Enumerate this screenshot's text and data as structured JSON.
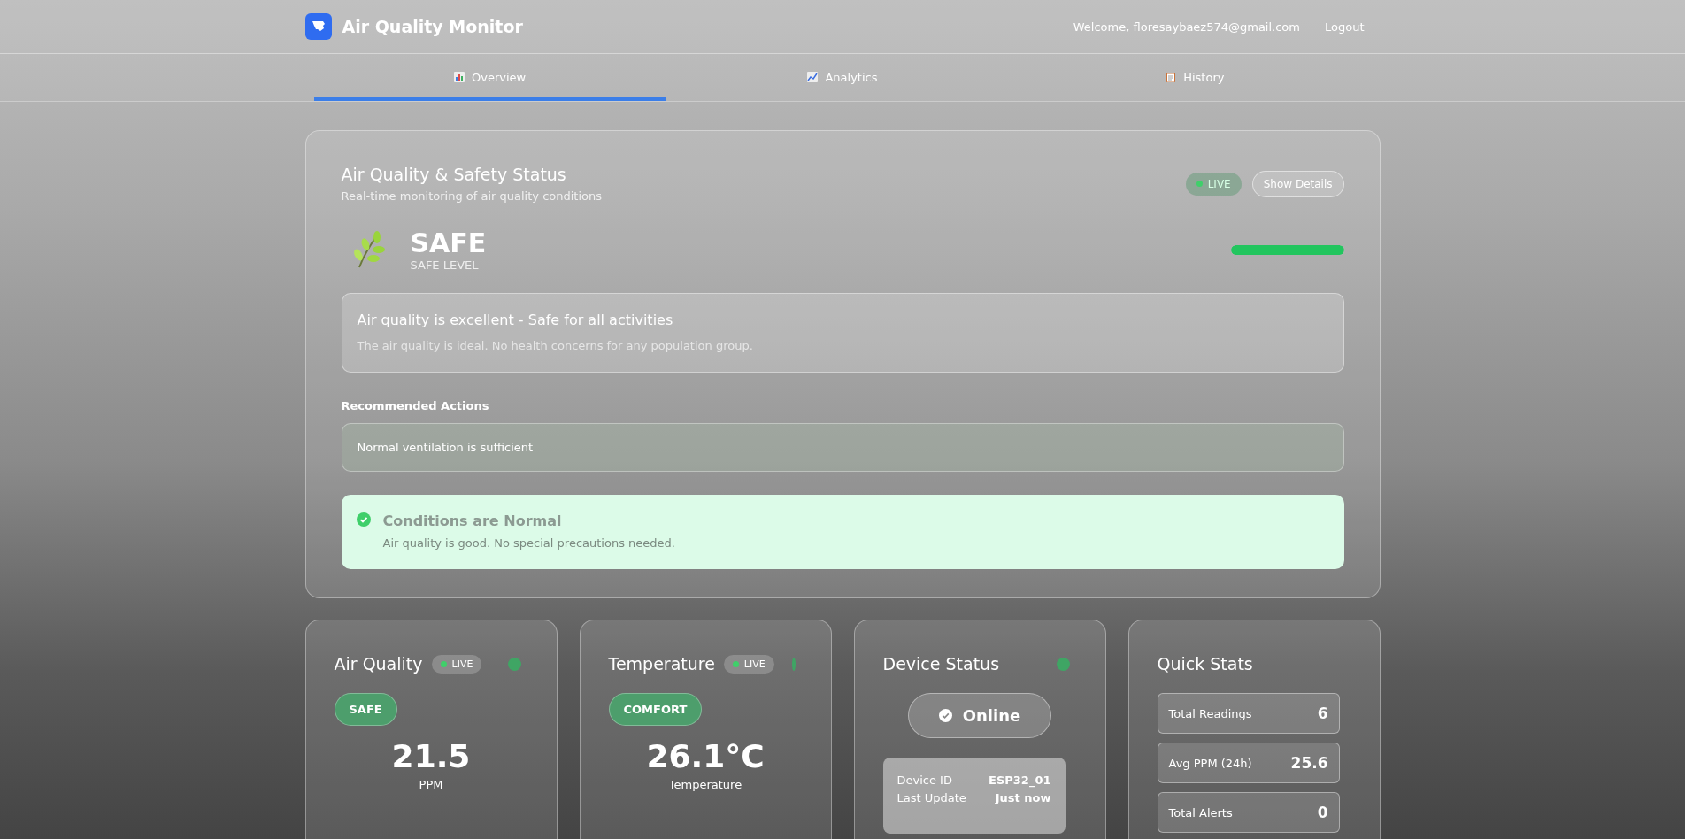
{
  "header": {
    "title": "Air Quality Monitor",
    "welcome": "Welcome, floresaybaez574@gmail.com",
    "logout": "Logout"
  },
  "tabs": [
    {
      "label": "Overview",
      "selected": true
    },
    {
      "label": "Analytics",
      "selected": false
    },
    {
      "label": "History",
      "selected": false
    }
  ],
  "status": {
    "title": "Air Quality & Safety Status",
    "subtitle": "Real-time monitoring of air quality conditions",
    "live": "LIVE",
    "details_button": "Show Details",
    "level_name": "SAFE",
    "level_caption": "SAFE LEVEL",
    "level": 1,
    "message_title": "Air quality is excellent - Safe for all activities",
    "message_body": "The air quality is ideal. No health concerns for any population group.",
    "actions_heading": "Recommended Actions",
    "actions": [
      "Normal ventilation is sufficient"
    ],
    "notice_title": "Conditions are Normal",
    "notice_body": "Air quality is good. No special precautions needed."
  },
  "cards": [
    {
      "kind": "reading",
      "title": "Air Quality",
      "live": "LIVE",
      "color": "#3fa564",
      "badge": "SAFE",
      "value": "21.5",
      "unit": "PPM"
    },
    {
      "kind": "reading",
      "title": "Temperature",
      "live": "LIVE",
      "color": "#3fa564",
      "badge": "COMFORT",
      "value": "26.1°C",
      "unit": "Temperature"
    },
    {
      "kind": "device",
      "title": "Device Status",
      "color": "#3fa564",
      "state": "Online",
      "rows": [
        {
          "label": "Device ID",
          "value": "ESP32_01"
        },
        {
          "label": "Last Update",
          "value": "Just now"
        }
      ]
    },
    {
      "kind": "stats",
      "title": "Quick Stats",
      "rows": [
        {
          "label": "Total Readings",
          "value": "6"
        },
        {
          "label": "Avg PPM (24h)",
          "value": "25.6"
        },
        {
          "label": "Total Alerts",
          "value": "0"
        }
      ]
    }
  ]
}
